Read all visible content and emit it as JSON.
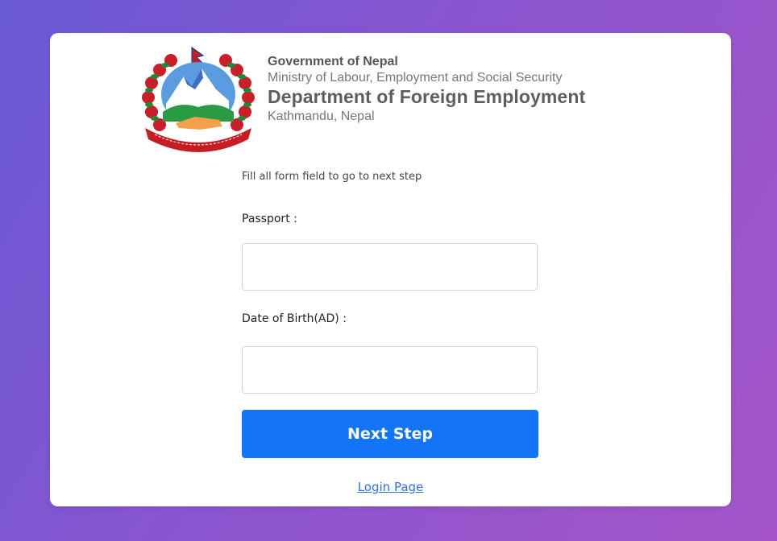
{
  "header": {
    "government": "Government of Nepal",
    "ministry": "Ministry of Labour, Employment and Social Security",
    "department": "Department of Foreign Employment",
    "location": "Kathmandu, Nepal"
  },
  "emblem": {
    "icon": "nepal-emblem-icon",
    "colors": {
      "flower": "#c8202a",
      "leaf": "#1d8a3a",
      "sky": "#5b9be0",
      "ribbon": "#c41e24"
    }
  },
  "form": {
    "instruction": "Fill all form field to go to next step",
    "passport_label": "Passport :",
    "passport_value": "",
    "dob_label": "Date of Birth(AD) :",
    "dob_value": "",
    "next_label": "Next Step",
    "login_label": "Login Page"
  },
  "colors": {
    "accent": "#1374f7",
    "link": "#2f6fe0",
    "bg_start": "#6a5ad6",
    "bg_end": "#a555c8"
  }
}
